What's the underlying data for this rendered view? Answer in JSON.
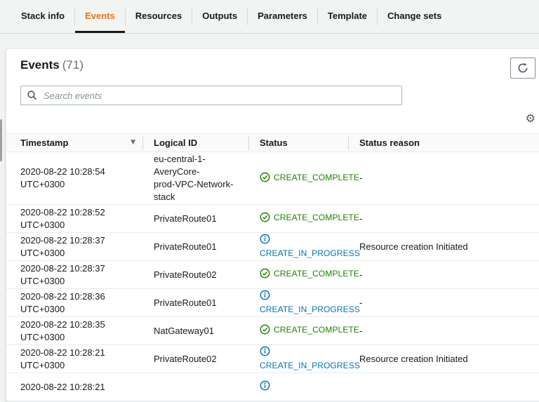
{
  "tabs": {
    "items": [
      {
        "label": "Stack info",
        "active": false
      },
      {
        "label": "Events",
        "active": true
      },
      {
        "label": "Resources",
        "active": false
      },
      {
        "label": "Outputs",
        "active": false
      },
      {
        "label": "Parameters",
        "active": false
      },
      {
        "label": "Template",
        "active": false
      },
      {
        "label": "Change sets",
        "active": false
      }
    ]
  },
  "panel": {
    "title": "Events",
    "count": "(71)",
    "search_placeholder": "Search events"
  },
  "icons": {
    "refresh": "refresh-arrow",
    "search": "magnifier",
    "settings_glyph": "⚙",
    "sort_desc_glyph": "▼",
    "status_complete": "check-circle",
    "status_in_progress": "info-circle"
  },
  "colors": {
    "accent_orange": "#ec7211",
    "success_green": "#1d8102",
    "info_blue": "#0073bb",
    "text": "#16191f",
    "secondary_text": "#687078",
    "border_light": "#eaeded",
    "page_background": "#f2f3f3"
  },
  "table": {
    "columns": [
      {
        "label": "Timestamp",
        "sortable": true
      },
      {
        "label": "Logical ID",
        "sortable": false
      },
      {
        "label": "Status",
        "sortable": false
      },
      {
        "label": "Status reason",
        "sortable": false
      }
    ],
    "rows": [
      {
        "timestamp": "2020-08-22 10:28:54\nUTC+0300",
        "logical_id": "eu-central-1-AveryCore-\nprod-VPC-Network-stack",
        "status": "CREATE_COMPLETE",
        "status_state": "complete",
        "reason": "-"
      },
      {
        "timestamp": "2020-08-22 10:28:52\nUTC+0300",
        "logical_id": "PrivateRoute01",
        "status": "CREATE_COMPLETE",
        "status_state": "complete",
        "reason": "-"
      },
      {
        "timestamp": "2020-08-22 10:28:37\nUTC+0300",
        "logical_id": "PrivateRoute01",
        "status": "CREATE_IN_PROGRESS",
        "status_state": "in_progress",
        "reason": "Resource creation Initiated"
      },
      {
        "timestamp": "2020-08-22 10:28:37\nUTC+0300",
        "logical_id": "PrivateRoute02",
        "status": "CREATE_COMPLETE",
        "status_state": "complete",
        "reason": "-"
      },
      {
        "timestamp": "2020-08-22 10:28:36\nUTC+0300",
        "logical_id": "PrivateRoute01",
        "status": "CREATE_IN_PROGRESS",
        "status_state": "in_progress",
        "reason": "-"
      },
      {
        "timestamp": "2020-08-22 10:28:35\nUTC+0300",
        "logical_id": "NatGateway01",
        "status": "CREATE_COMPLETE",
        "status_state": "complete",
        "reason": "-"
      },
      {
        "timestamp": "2020-08-22 10:28:21\nUTC+0300",
        "logical_id": "PrivateRoute02",
        "status": "CREATE_IN_PROGRESS",
        "status_state": "in_progress",
        "reason": "Resource creation Initiated"
      },
      {
        "timestamp": "2020-08-22 10:28:21",
        "logical_id": "",
        "status": "",
        "status_state": "in_progress",
        "reason": ""
      }
    ]
  }
}
